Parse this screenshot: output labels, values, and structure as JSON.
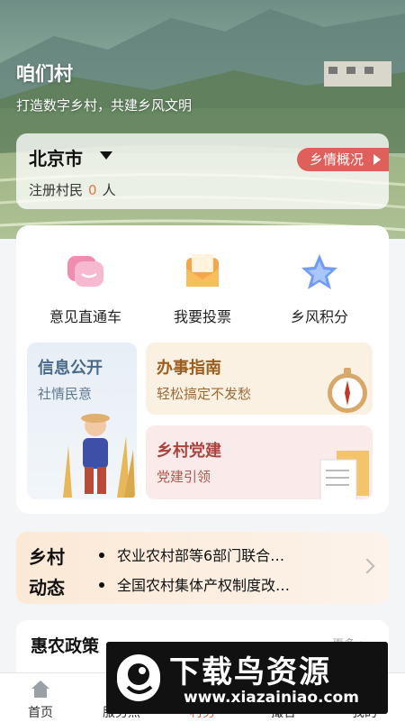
{
  "header": {
    "village_title": "咱们村",
    "slogan": "打造数字乡村，共建乡风文明"
  },
  "location": {
    "city": "北京市",
    "residents_prefix": "注册村民",
    "residents_count": "0",
    "residents_suffix": "人",
    "overview_label": "乡情概况"
  },
  "quick_actions": [
    {
      "label": "意见直通车",
      "icon": "chat-bubble-icon"
    },
    {
      "label": "我要投票",
      "icon": "envelope-icon"
    },
    {
      "label": "乡风积分",
      "icon": "star-icon"
    }
  ],
  "tiles": {
    "info": {
      "title": "信息公开",
      "subtitle": "社情民意"
    },
    "guide": {
      "title": "办事指南",
      "subtitle": "轻松搞定不发愁"
    },
    "party": {
      "title": "乡村党建",
      "subtitle": "党建引领"
    }
  },
  "news": {
    "tag_line1": "乡村",
    "tag_line2": "动态",
    "items": [
      "农业农村部等6部门联合…",
      "全国农村集体产权制度改…"
    ]
  },
  "policy": {
    "title": "惠农政策",
    "more": "更多 >"
  },
  "tabbar": [
    {
      "label": "首页",
      "icon": "home-icon"
    },
    {
      "label": "服务点",
      "icon": "store-icon"
    },
    {
      "label": "村务",
      "icon": "village-icon"
    },
    {
      "label": "撮合",
      "icon": "handshake-icon"
    },
    {
      "label": "我的",
      "icon": "user-icon"
    }
  ],
  "watermark": {
    "title": "下载鸟资源",
    "url": "www.xiazainiao.com"
  },
  "colors": {
    "accent_red": "#df5f5a",
    "count_orange": "#e8744a",
    "tab_active": "#e05a4f"
  }
}
